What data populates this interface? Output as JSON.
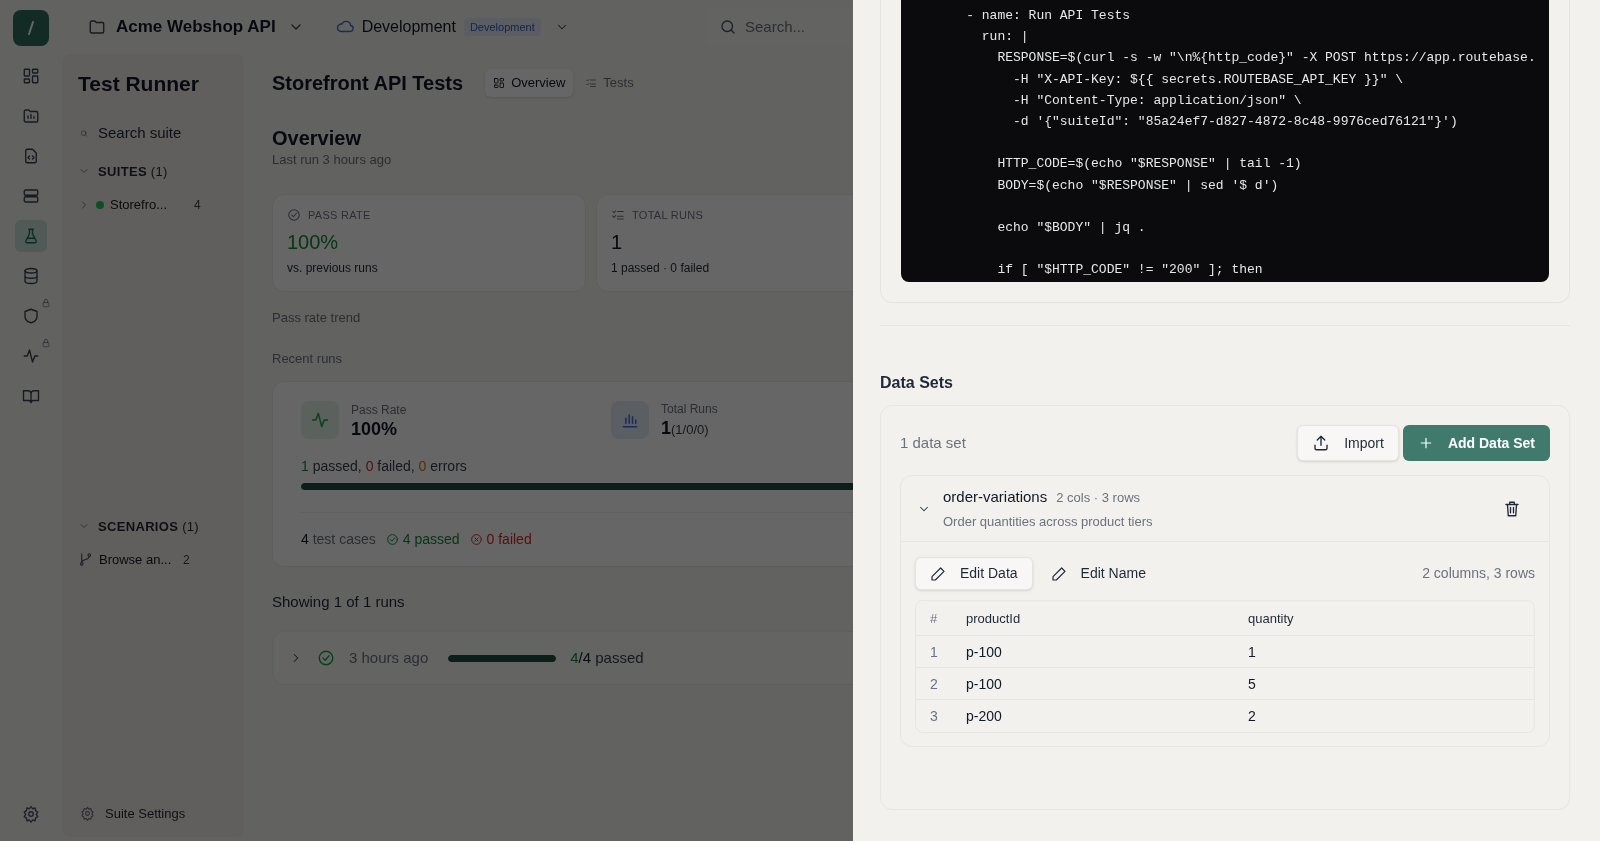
{
  "topbar": {
    "project": "Acme Webshop API",
    "environment": "Development",
    "environment_badge": "Development",
    "search": {
      "placeholder": "Search..."
    }
  },
  "rail": {
    "items": [
      {
        "selected": false,
        "locked": false
      },
      {
        "selected": false,
        "locked": false
      },
      {
        "selected": false,
        "locked": false
      },
      {
        "selected": false,
        "locked": false
      },
      {
        "selected": true,
        "locked": false
      },
      {
        "selected": false,
        "locked": false
      },
      {
        "selected": false,
        "locked": true
      },
      {
        "selected": false,
        "locked": true
      },
      {
        "selected": false,
        "locked": false
      }
    ]
  },
  "sidebar": {
    "title": "Test Runner",
    "search": {
      "placeholder": "Search suite"
    },
    "sections": [
      {
        "kind": "suites",
        "title": "SUITES",
        "count": "(1)",
        "expanded": true,
        "items": [
          {
            "label": "Storefro...",
            "count": "4"
          }
        ]
      },
      {
        "kind": "scenarios",
        "title": "SCENARIOS",
        "count": "(1)",
        "expanded": true,
        "items": [
          {
            "label": "Browse an...",
            "count": "2"
          }
        ]
      }
    ],
    "footer": "Suite Settings"
  },
  "main": {
    "title": "Storefront API Tests",
    "tabs": [
      {
        "label": "Overview",
        "selected": true
      },
      {
        "label": "Tests",
        "selected": false
      }
    ],
    "heading": "Overview",
    "subheading": "Last run 3 hours ago",
    "stats": [
      {
        "kind": "pass",
        "label": "PASS RATE",
        "value": "100%",
        "note": "vs. previous runs"
      },
      {
        "kind": "runs",
        "label": "TOTAL RUNS",
        "value": "1",
        "note": "1 passed · 0 failed"
      }
    ],
    "trend_label": "Pass rate trend",
    "recent_label": "Recent runs",
    "recent": {
      "metrics": [
        {
          "kind": "pass",
          "label": "Pass Rate",
          "value": "100%"
        },
        {
          "kind": "runs",
          "label": "Total Runs",
          "value": "1",
          "extra": "(1/0/0)"
        }
      ],
      "summary": [
        {
          "kind": "passed",
          "count": "1",
          "label": "passed,"
        },
        {
          "kind": "failed",
          "count": "0",
          "label": "failed,"
        },
        {
          "kind": "errors",
          "count": "0",
          "label": "errors"
        }
      ],
      "level": 1,
      "cases": {
        "count": "4",
        "label": "test cases",
        "passed": "4 passed",
        "failed": "0 failed"
      }
    },
    "showing": "Showing 1 of 1 runs",
    "runs": [
      {
        "time": "3 hours ago",
        "level": 1,
        "passed": "4",
        "total": "/4",
        "label": "passed",
        "expanded": false
      }
    ]
  },
  "drawer": {
    "code": "    - name: Run API Tests\n      run: |\n        RESPONSE=$(curl -s -w \"\\n%{http_code}\" -X POST https://app.routebase.\n          -H \"X-API-Key: ${{ secrets.ROUTEBASE_API_KEY }}\" \\\n          -H \"Content-Type: application/json\" \\\n          -d '{\"suiteId\": \"85a24ef7-d827-4872-8c48-9976ced76121\"}')\n\n        HTTP_CODE=$(echo \"$RESPONSE\" | tail -1)\n        BODY=$(echo \"$RESPONSE\" | sed '$ d')\n\n        echo \"$BODY\" | jq .\n\n        if [ \"$HTTP_CODE\" != \"200\" ]; then",
    "data_sets": {
      "heading": "Data Sets",
      "count": "1 data set",
      "import": "Import",
      "add": "Add Data Set",
      "items": [
        {
          "name": "order-variations",
          "meta": "2 cols · 3 rows",
          "description": "Order quantities across product tiers",
          "expanded": true,
          "edit_data": "Edit Data",
          "edit_name": "Edit Name",
          "size": "2 columns, 3 rows",
          "columns": [
            "#",
            "productId",
            "quantity"
          ],
          "rows": [
            [
              "1",
              "p-100",
              "1"
            ],
            [
              "2",
              "p-100",
              "5"
            ],
            [
              "3",
              "p-200",
              "2"
            ]
          ]
        }
      ]
    }
  }
}
